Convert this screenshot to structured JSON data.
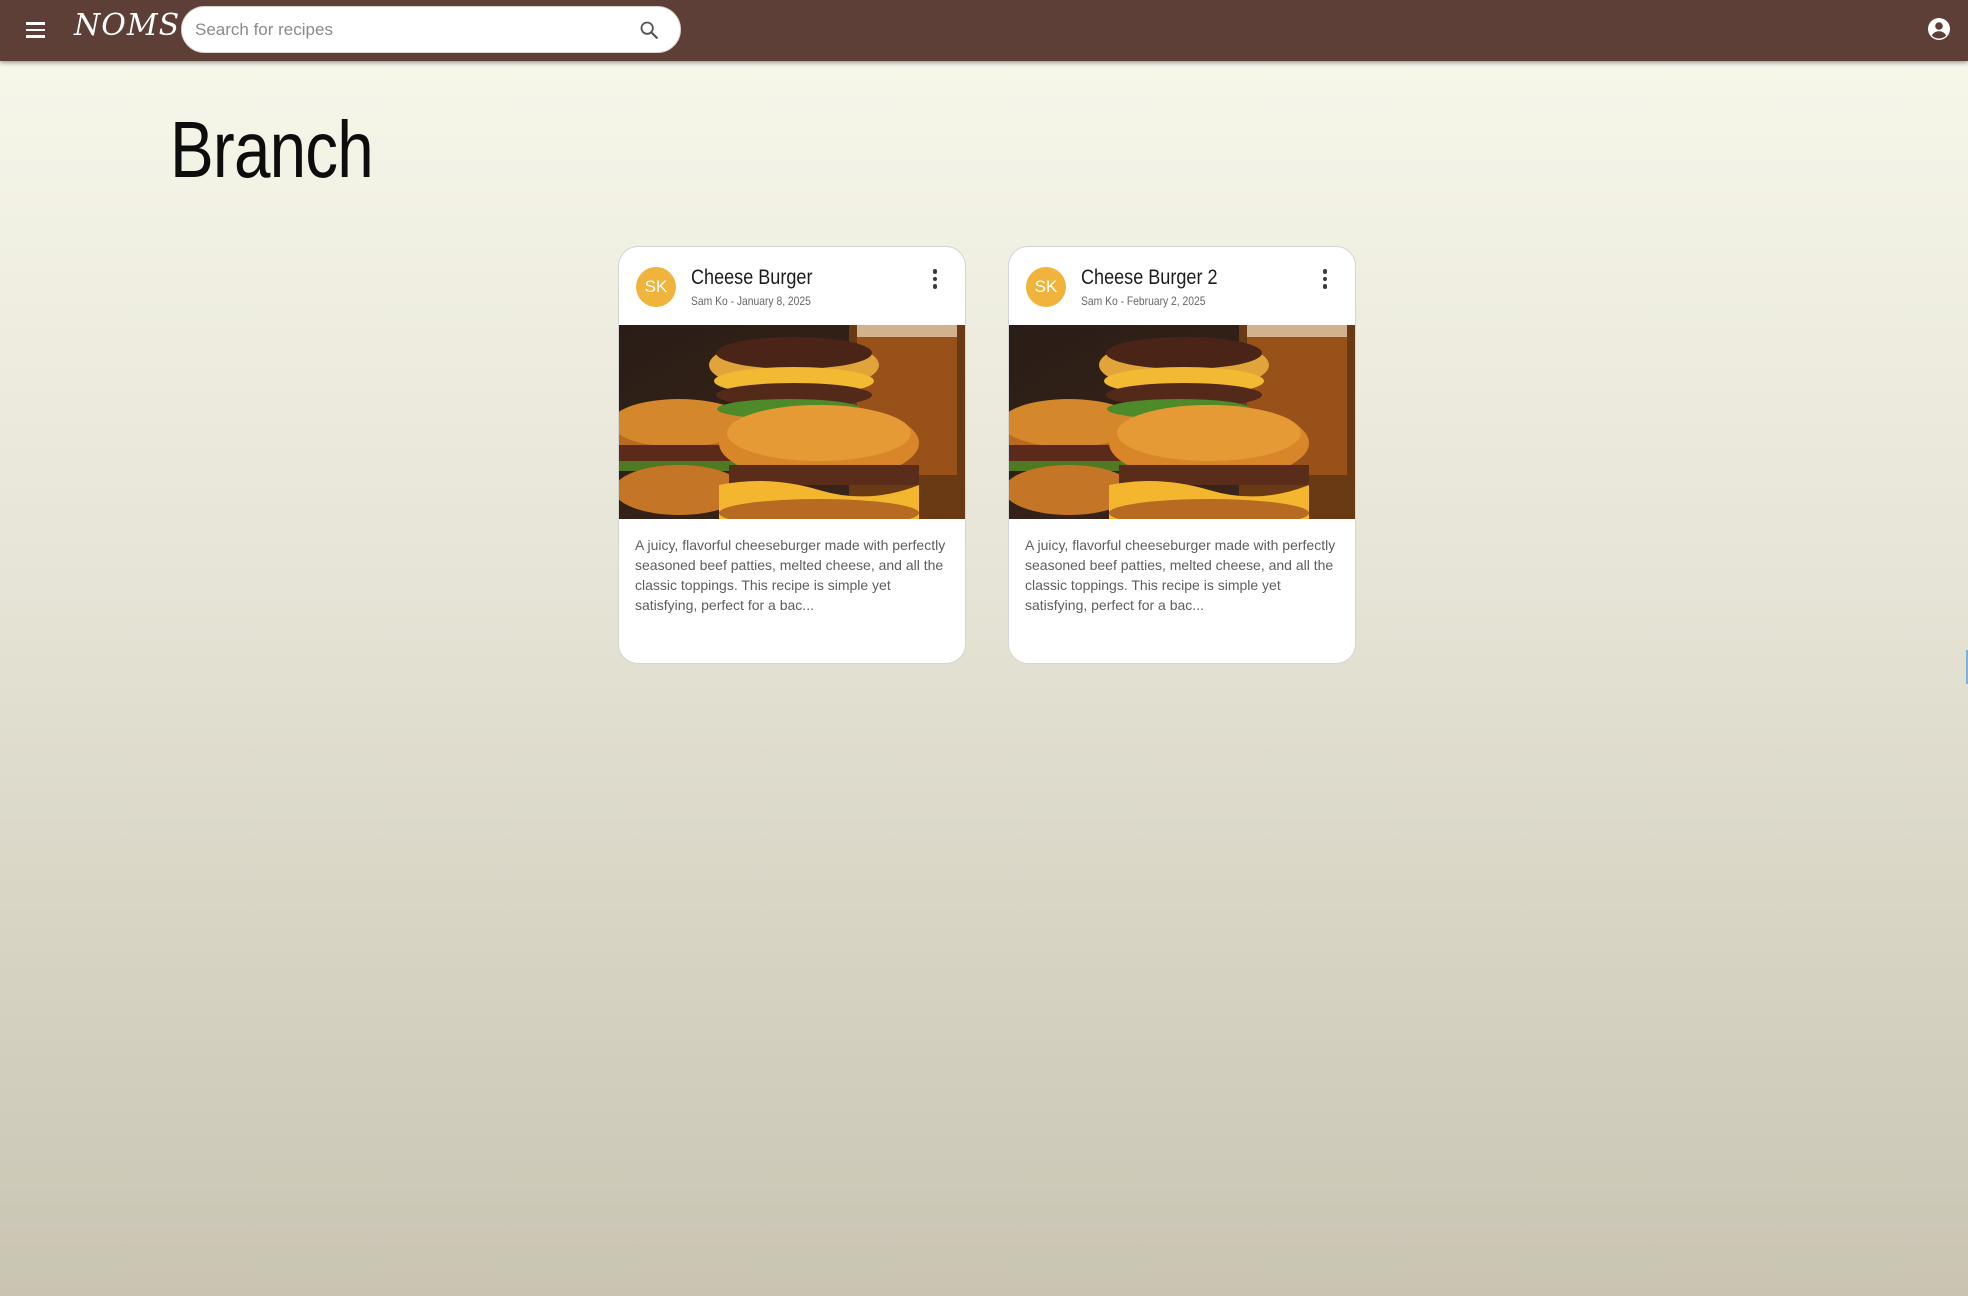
{
  "header": {
    "logo": "NOMS",
    "search_placeholder": "Search for recipes",
    "icons": {
      "menu": "menu-icon",
      "search": "search-icon",
      "account": "account-circle-icon"
    }
  },
  "page": {
    "title": "Branch"
  },
  "recipes": [
    {
      "initials": "SK",
      "title": "Cheese Burger",
      "meta": "Sam Ko - January 8, 2025",
      "description": "A juicy, flavorful cheeseburger made with perfectly seasoned beef patties, melted cheese, and all the classic toppings. This recipe is simple yet satisfying, perfect for a bac..."
    },
    {
      "initials": "SK",
      "title": "Cheese Burger 2",
      "meta": "Sam Ko - February 2, 2025",
      "description": "A juicy, flavorful cheeseburger made with perfectly seasoned beef patties, melted cheese, and all the classic toppings. This recipe is simple yet satisfying, perfect for a bac..."
    }
  ],
  "colors": {
    "header": "#5d3f37",
    "avatar": "#f0b43c"
  }
}
